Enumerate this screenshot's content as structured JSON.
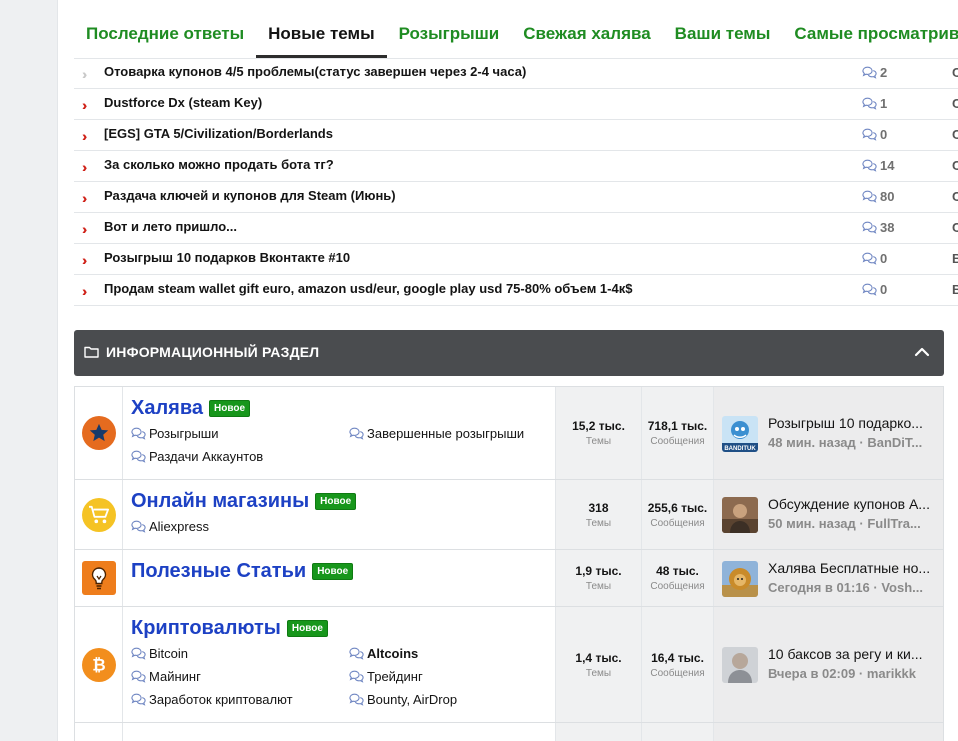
{
  "tabs": [
    "Последние ответы",
    "Новые темы",
    "Розыгрыши",
    "Свежая халява",
    "Ваши темы",
    "Самые просматрива"
  ],
  "threads": [
    {
      "title": "Отоварка купонов 4/5 проблемы(статус завершен через 2-4 часа)",
      "replies": "2",
      "last": "C"
    },
    {
      "title": "Dustforce Dx (steam Key)",
      "replies": "1",
      "last": "C"
    },
    {
      "title": "[EGS] GTA 5/Civilization/Borderlands",
      "replies": "0",
      "last": "C"
    },
    {
      "title": "За сколько можно продать бота тг?",
      "replies": "14",
      "last": "C"
    },
    {
      "title": "Раздача ключей и купонов для Steam (Июнь)",
      "replies": "80",
      "last": "C"
    },
    {
      "title": "Вот и лето пришло...",
      "replies": "38",
      "last": "C"
    },
    {
      "title": "Розыгрыш 10 подарков Вконтакте #10",
      "replies": "0",
      "last": "B"
    },
    {
      "title": "Продам steam wallet gift euro, amazon usd/eur, google play usd 75-80% объем 1-4к$",
      "replies": "0",
      "last": "B"
    }
  ],
  "category": {
    "title": "ИНФОРМАЦИОННЫЙ РАЗДЕЛ"
  },
  "badge_new": "Новое",
  "stat_labels": {
    "threads": "Темы",
    "messages": "Сообщения"
  },
  "forums": [
    {
      "name": "Халява",
      "icon": "star-icon",
      "icon_color": "#e56b1f",
      "subforums": [
        {
          "label": "Розыгрыши",
          "bold": false
        },
        {
          "label": "Завершенные розыгрыши",
          "bold": false
        },
        {
          "label": "Раздачи Аккаунтов",
          "bold": false
        }
      ],
      "threads": "15,2 тыс.",
      "messages": "718,1 тыс.",
      "last_title": "Розыгрыш 10 подарко...",
      "last_meta": "48 мин. назад · BanDiT...",
      "avatar_label": "BANDITUK"
    },
    {
      "name": "Онлайн магазины",
      "icon": "cart-icon",
      "icon_color": "#f5c324",
      "subforums": [
        {
          "label": "Aliexpress",
          "bold": false
        }
      ],
      "threads": "318",
      "messages": "255,6 тыс.",
      "last_title": "Обсуждение купонов А...",
      "last_meta": "50 мин. назад · FullTra..."
    },
    {
      "name": "Полезные Статьи",
      "icon": "lightbulb-icon",
      "icon_color": "#ee7d1c",
      "subforums": [],
      "threads": "1,9 тыс.",
      "messages": "48 тыс.",
      "last_title": "Халява Бесплатные но...",
      "last_meta": "Сегодня в 01:16 · Vosh..."
    },
    {
      "name": "Криптовалюты",
      "icon": "bitcoin-icon",
      "icon_color": "#f28e1d",
      "subforums": [
        {
          "label": "Bitcoin",
          "bold": false
        },
        {
          "label": "Altcoins",
          "bold": true
        },
        {
          "label": "Майнинг",
          "bold": false
        },
        {
          "label": "Трейдинг",
          "bold": false
        },
        {
          "label": "Заработок криптовалют",
          "bold": false
        },
        {
          "label": "Bounty, AirDrop",
          "bold": false
        }
      ],
      "threads": "1,4 тыс.",
      "messages": "16,4 тыс.",
      "last_title": "10 баксов за регу и ки...",
      "last_meta": "Вчера в 02:09 · marikkk"
    }
  ],
  "colors": {
    "link_green": "#1f8c22",
    "forum_blue": "#1d41c4",
    "chevron_red": "#d0231a",
    "category_bg": "#4a4c4f",
    "badge_green": "#17961b"
  }
}
